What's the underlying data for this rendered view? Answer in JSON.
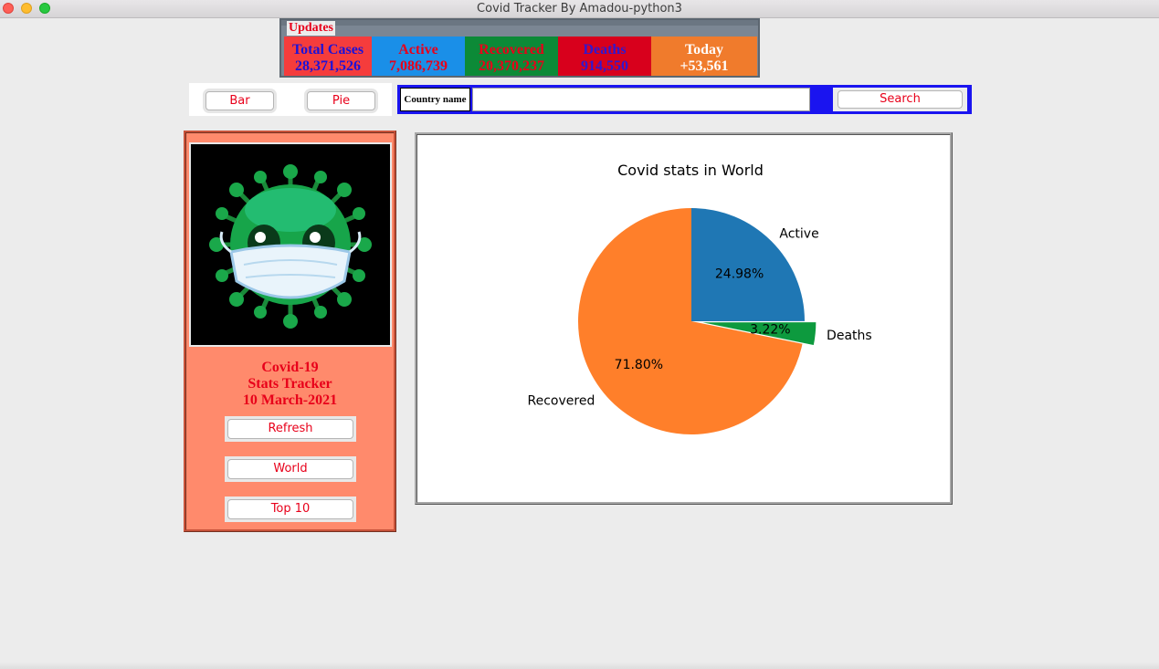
{
  "window": {
    "title": "Covid Tracker By Amadou-python3"
  },
  "updates": {
    "legend": "Updates",
    "total_cases": {
      "label": "Total Cases",
      "value": "28,371,526"
    },
    "active": {
      "label": "Active",
      "value": "7,086,739"
    },
    "recovered": {
      "label": "Recovered",
      "value": "20,370,237"
    },
    "deaths": {
      "label": "Deaths",
      "value": "914,550"
    },
    "today": {
      "label": "Today",
      "value": "+53,561"
    }
  },
  "chart_buttons": {
    "bar": "Bar",
    "pie": "Pie"
  },
  "search": {
    "label": "Country name",
    "value": "",
    "button": "Search"
  },
  "sidebar": {
    "title_line1": "Covid-19",
    "title_line2": "Stats Tracker",
    "title_line3": "10 March-2021",
    "refresh": "Refresh",
    "world": "World",
    "top10": "Top 10"
  },
  "chart_data": {
    "type": "pie",
    "title": "Covid stats in World",
    "slices": [
      {
        "label": "Active",
        "value": 24.98,
        "pct_label": "24.98%",
        "color": "#1f77b4",
        "explode": false
      },
      {
        "label": "Deaths",
        "value": 3.22,
        "pct_label": "3.22%",
        "color": "#0d9a3e",
        "explode": true
      },
      {
        "label": "Recovered",
        "value": 71.8,
        "pct_label": "71.80%",
        "color": "#ff7f2a",
        "explode": false
      }
    ],
    "start_angle_deg": 90,
    "direction": "clockwise"
  }
}
